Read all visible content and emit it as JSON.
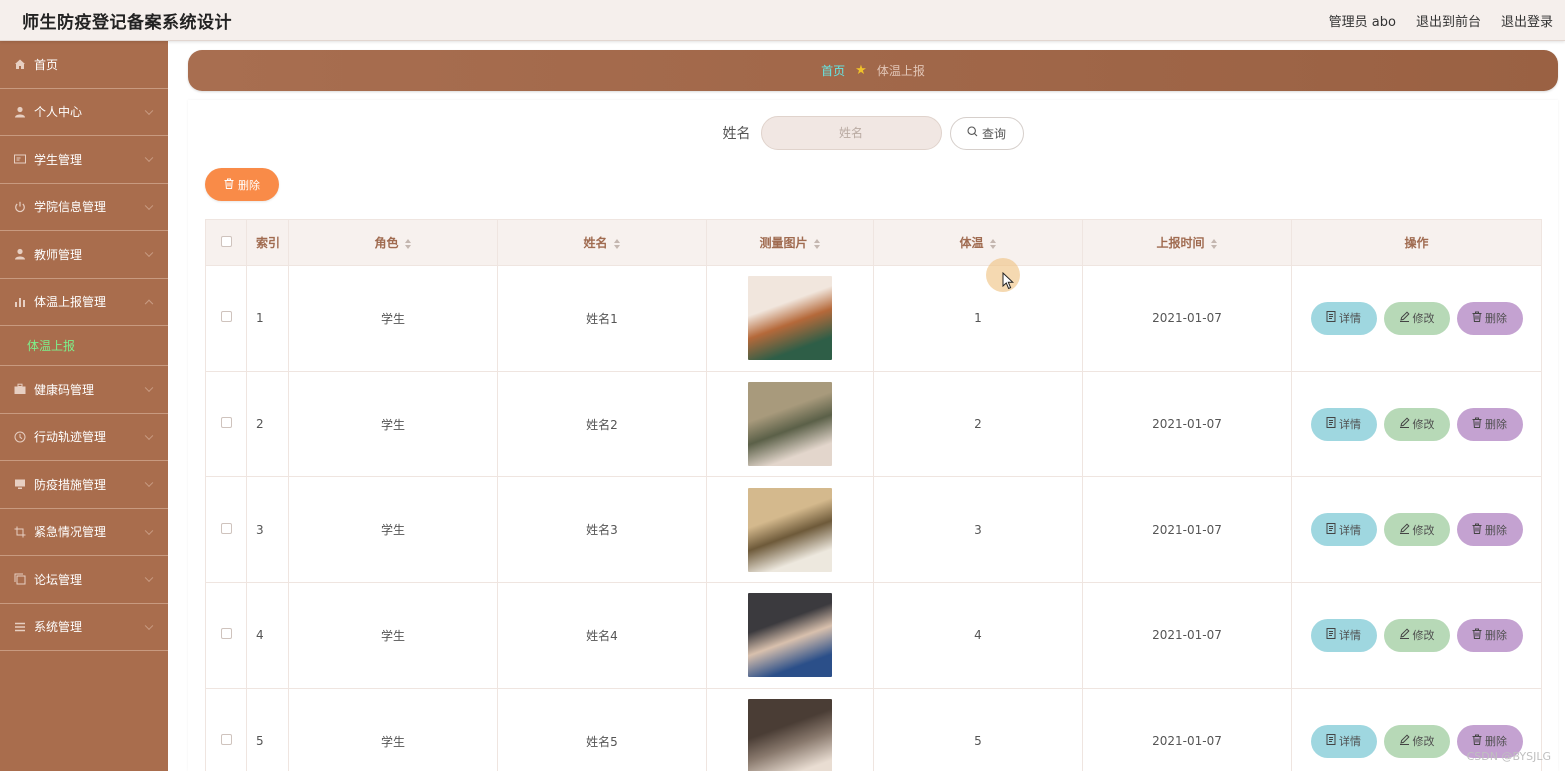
{
  "header": {
    "title": "师生防疫登记备案系统设计",
    "links": [
      "管理员 abo",
      "退出到前台",
      "退出登录"
    ]
  },
  "sidebar": {
    "items": [
      {
        "label": "首页",
        "icon": "home-icon",
        "chevron": false
      },
      {
        "label": "个人中心",
        "icon": "user-icon",
        "chevron": true
      },
      {
        "label": "学生管理",
        "icon": "id-card-icon",
        "chevron": true
      },
      {
        "label": "学院信息管理",
        "icon": "power-icon",
        "chevron": true
      },
      {
        "label": "教师管理",
        "icon": "user-icon",
        "chevron": true
      },
      {
        "label": "体温上报管理",
        "icon": "bar-chart-icon",
        "chevron": true,
        "expanded": true
      },
      {
        "label": "健康码管理",
        "icon": "briefcase-icon",
        "chevron": true
      },
      {
        "label": "行动轨迹管理",
        "icon": "clock-icon",
        "chevron": true
      },
      {
        "label": "防疫措施管理",
        "icon": "monitor-icon",
        "chevron": true
      },
      {
        "label": "紧急情况管理",
        "icon": "crop-icon",
        "chevron": true
      },
      {
        "label": "论坛管理",
        "icon": "copy-icon",
        "chevron": true
      },
      {
        "label": "系统管理",
        "icon": "menu-icon",
        "chevron": true
      }
    ],
    "submenu": "体温上报"
  },
  "breadcrumb": {
    "home": "首页",
    "current": "体温上报"
  },
  "search": {
    "label": "姓名",
    "placeholder": "姓名",
    "button": "查询"
  },
  "toolbar": {
    "delete_label": "删除"
  },
  "table": {
    "columns": [
      "索引",
      "角色",
      "姓名",
      "测量图片",
      "体温",
      "上报时间",
      "操作"
    ],
    "rows": [
      {
        "index": "1",
        "role": "学生",
        "name": "姓名1",
        "temp": "1",
        "time": "2021-01-07",
        "photo_colors": [
          "#f1e6dd",
          "#2e5e47",
          "#b5693a"
        ]
      },
      {
        "index": "2",
        "role": "学生",
        "name": "姓名2",
        "temp": "2",
        "time": "2021-01-07",
        "photo_colors": [
          "#a89a7c",
          "#e3d6cc",
          "#5b6048"
        ]
      },
      {
        "index": "3",
        "role": "学生",
        "name": "姓名3",
        "temp": "3",
        "time": "2021-01-07",
        "photo_colors": [
          "#d4b98d",
          "#ede8de",
          "#6e5a3a"
        ]
      },
      {
        "index": "4",
        "role": "学生",
        "name": "姓名4",
        "temp": "4",
        "time": "2021-01-07",
        "photo_colors": [
          "#3b3a3e",
          "#2b4f89",
          "#d8c0ad"
        ]
      },
      {
        "index": "5",
        "role": "学生",
        "name": "姓名5",
        "temp": "5",
        "time": "2021-01-07",
        "photo_colors": [
          "#4a3d35",
          "#e9ddd2",
          "#8a7a6e"
        ]
      }
    ],
    "actions": {
      "detail": "详情",
      "edit": "修改",
      "delete": "删除"
    }
  },
  "watermark": "CSDN @BYSJLG",
  "colors": {
    "sidebar": "#a96d4d",
    "banner": "#a86e50",
    "accent_green": "#7df08a",
    "accent_cyan": "#65e7e5",
    "delete_orange": "#f98b48"
  }
}
